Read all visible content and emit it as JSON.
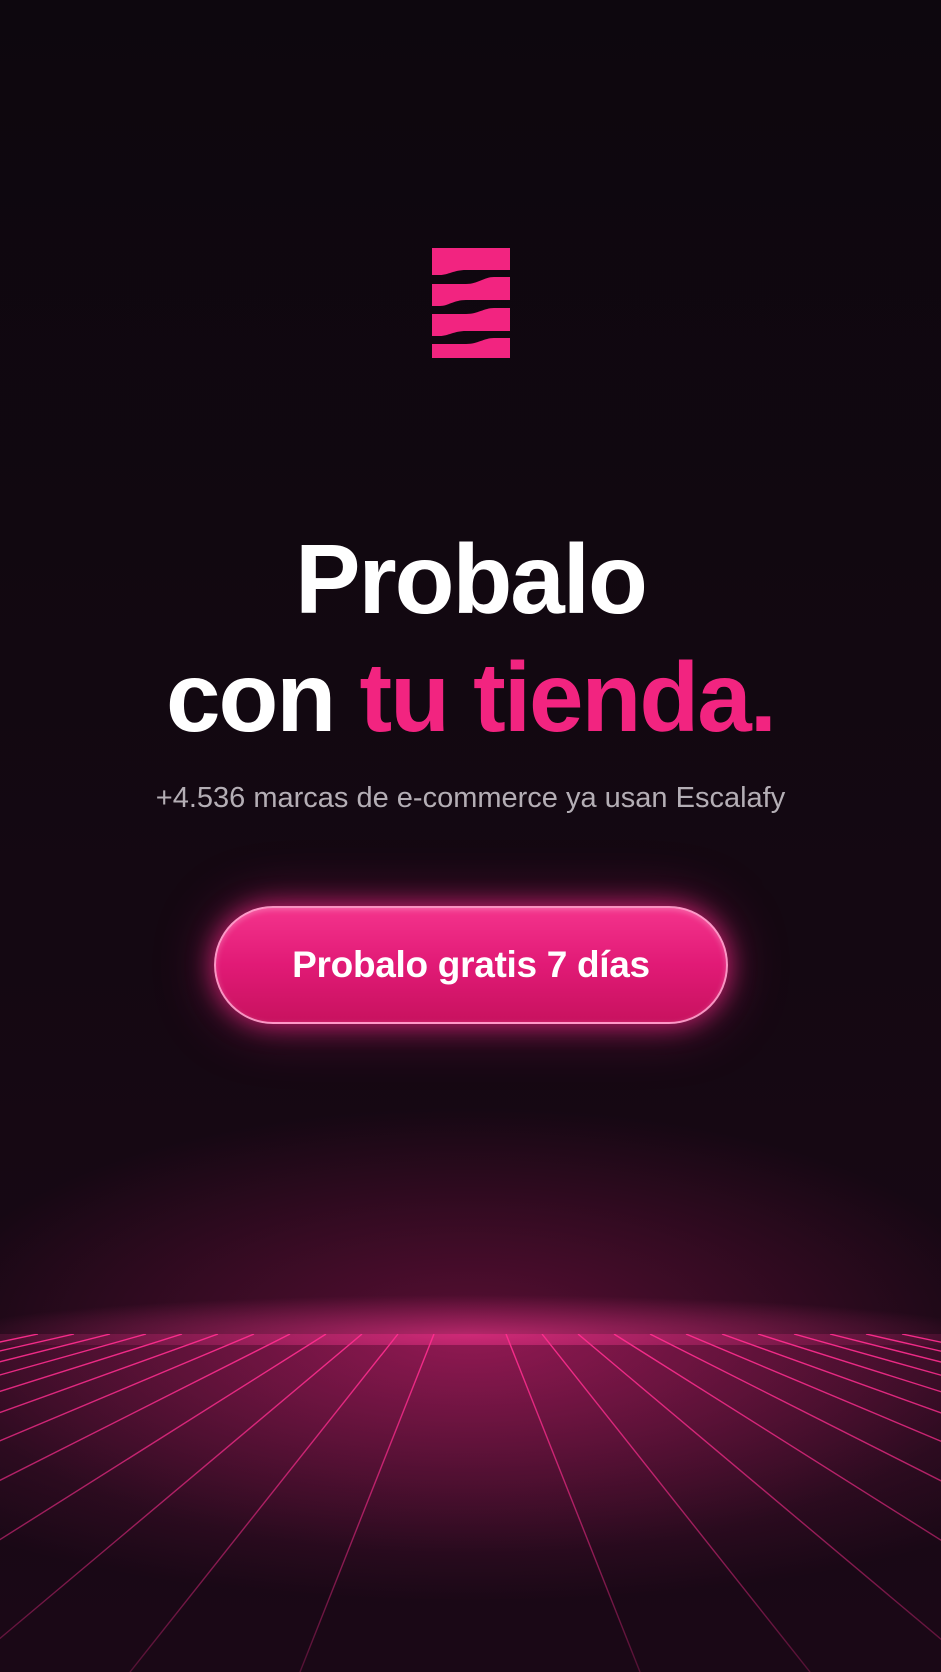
{
  "brand": {
    "logo_icon": "escalafy-stripes-logo",
    "accent_color": "#f22480",
    "background_color": "#0f0711"
  },
  "headline": {
    "line1": "Probalo",
    "line2_plain": "con",
    "line2_accent": "tu tienda."
  },
  "subtext": "+4.536 marcas de e-commerce ya usan Escalafy",
  "cta": {
    "label": "Probalo gratis 7 días"
  }
}
